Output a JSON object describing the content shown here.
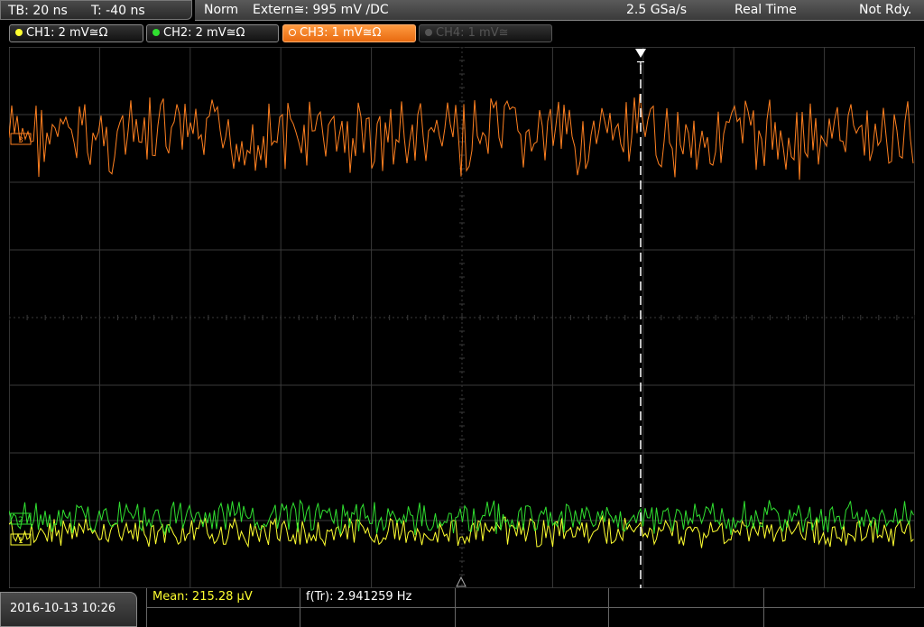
{
  "topbar": {
    "timebase": "TB: 20 ns",
    "trigger_time": "T: -40 ns",
    "mode": "Norm",
    "trigger_source": "Extern≅: 995 mV ∕DC",
    "sample_rate": "2.5 GSa/s",
    "acq_mode": "Real Time",
    "status": "Not Rdy."
  },
  "channels": [
    {
      "label": "CH1: 2 mV≅Ω",
      "color": "#ffff30",
      "state": "on"
    },
    {
      "label": "CH2: 2 mV≅Ω",
      "color": "#30e030",
      "state": "on"
    },
    {
      "label": "CH3: 1 mV≅Ω",
      "color": "#ff8020",
      "state": "active"
    },
    {
      "label": "CH4: 1 mV≅",
      "color": "#555555",
      "state": "off"
    }
  ],
  "markers": {
    "trigger": "T",
    "ch3_ref": "3",
    "ch2_ref": "2",
    "ch1_ref": "1"
  },
  "bottombar": {
    "datetime": "2016-10-13 10:26",
    "mean": "Mean: 215.28 μV",
    "freq": "f(Tr): 2.941259 Hz"
  },
  "colors": {
    "ch1": "#ffff30",
    "ch2": "#30e030",
    "ch3": "#ff8020",
    "grid": "#555555"
  }
}
